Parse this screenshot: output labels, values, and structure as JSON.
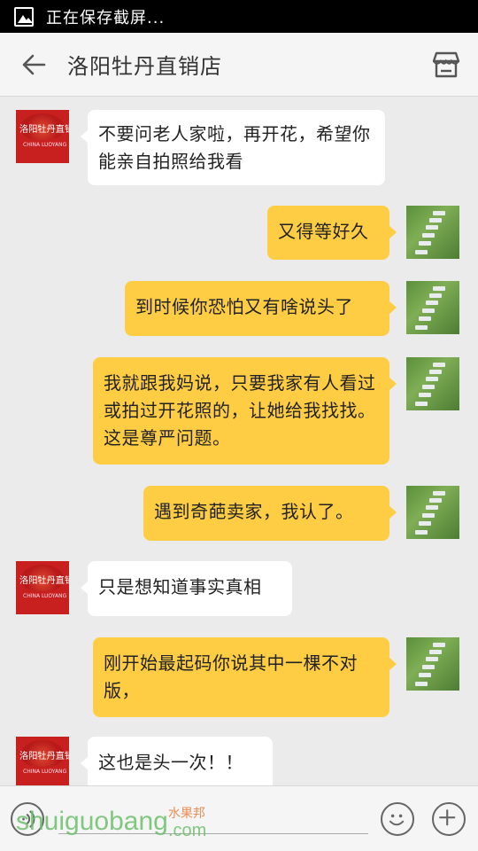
{
  "status_bar": {
    "text": "正在保存截屏..."
  },
  "header": {
    "title": "洛阳牡丹直销店",
    "back_icon": "arrow-left-icon",
    "store_icon": "store-icon"
  },
  "messages": [
    {
      "side": "left",
      "text": "不要问老人家啦，再开花，希望你能亲自拍照给我看"
    },
    {
      "side": "right",
      "text": "又得等好久"
    },
    {
      "side": "right",
      "text": "到时候你恐怕又有啥说头了"
    },
    {
      "side": "right",
      "text": "我就跟我妈说，只要我家有人看过或拍过开花照的，让她给我找找。这是尊严问题。"
    },
    {
      "side": "right",
      "text": "遇到奇葩卖家，我认了。"
    },
    {
      "side": "left",
      "text": "只是想知道事实真相"
    },
    {
      "side": "right",
      "text": "刚开始最起码你说其中一棵不对版，"
    },
    {
      "side": "left",
      "text": "这也是头一次！！"
    }
  ],
  "avatar_logo": {
    "text": "洛阳牡丹直销店",
    "sub": "CHINA LUOYANG"
  },
  "input_bar": {
    "value": "",
    "voice_icon": "voice-icon",
    "emoji_icon": "emoji-icon",
    "plus_icon": "plus-icon"
  },
  "watermark": {
    "text": "shuiguobang",
    "cn": "水果邦",
    "com": ".com"
  },
  "colors": {
    "right_bubble": "#ffcd44",
    "left_bubble": "#ffffff",
    "background": "#ebebeb",
    "avatar_red": "#c81f1f"
  }
}
